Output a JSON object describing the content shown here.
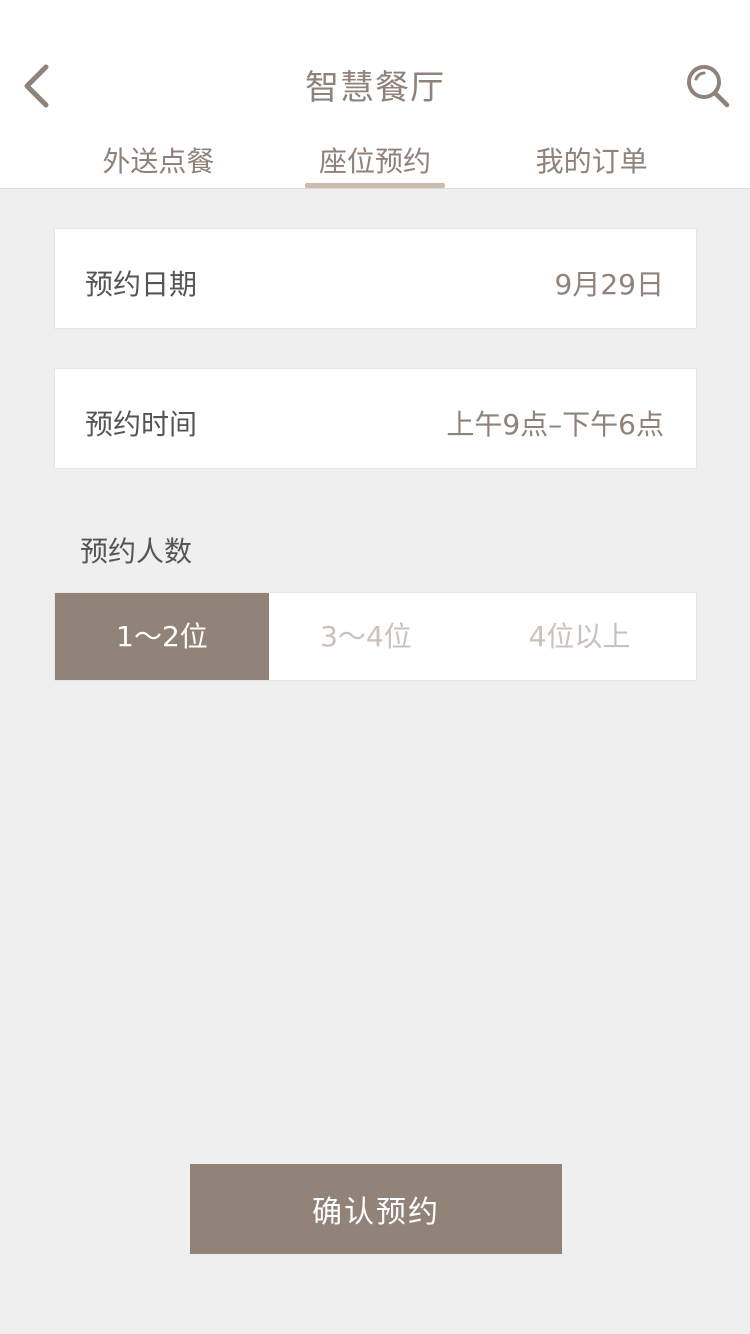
{
  "header": {
    "title": "智慧餐厅",
    "back_icon": "chevron-left-icon",
    "search_icon": "search-icon"
  },
  "tabs": [
    {
      "label": "外送点餐",
      "active": false
    },
    {
      "label": "座位预约",
      "active": true
    },
    {
      "label": "我的订单",
      "active": false
    }
  ],
  "form": {
    "date": {
      "label": "预约日期",
      "value": "9月29日"
    },
    "time": {
      "label": "预约时间",
      "value": "上午9点–下午6点"
    },
    "party_size": {
      "label": "预约人数",
      "options": [
        "1～2位",
        "3～4位",
        "4位以上"
      ],
      "selected_index": 0
    }
  },
  "confirm_label": "确认预约",
  "colors": {
    "accent": "#928379",
    "tab_underline": "#cbbcac",
    "background": "#efefef"
  }
}
